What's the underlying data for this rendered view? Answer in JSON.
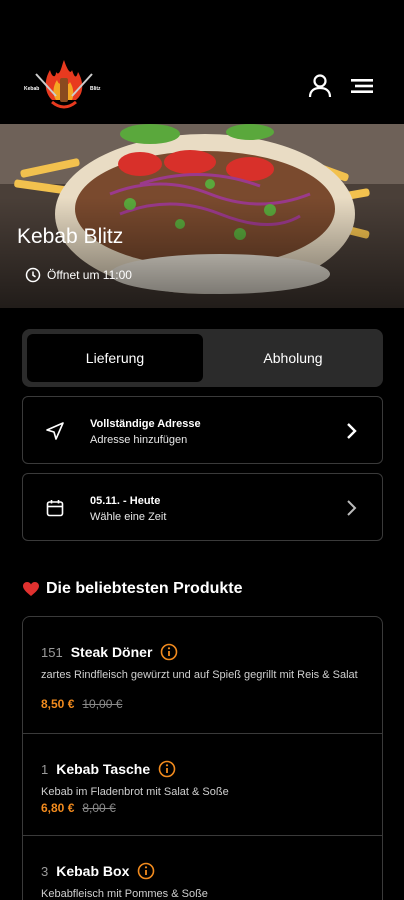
{
  "brand": {
    "name": "Kebab Blitz",
    "logo_text_left": "Kebab",
    "logo_text_right": "Blitz"
  },
  "header": {
    "account_icon": "user-icon",
    "menu_icon": "menu-icon"
  },
  "hero": {
    "title": "Kebab Blitz",
    "hours": "Öffnet um 11:00",
    "hours_icon": "clock-icon"
  },
  "order_mode": {
    "active": "Lieferung",
    "inactive": "Abholung"
  },
  "address": {
    "title": "Vollständige Adresse",
    "subtitle": "Adresse hinzufügen",
    "icon": "location-arrow-icon"
  },
  "time": {
    "title": "05.11. - Heute",
    "subtitle": "Wähle eine Zeit",
    "icon": "calendar-icon"
  },
  "popular": {
    "title": "Die beliebtesten Produkte",
    "icon": "heart-icon"
  },
  "products": [
    {
      "number": "151",
      "name": "Steak Döner",
      "description": "zartes Rindfleisch gewürzt und auf Spieß gegrillt mit Reis & Salat",
      "price": "8,50 €",
      "old_price": "10,00 €"
    },
    {
      "number": "1",
      "name": "Kebab Tasche",
      "description": "Kebab im Fladenbrot mit Salat & Soße",
      "price": "6,80 €",
      "old_price": "8,00 €"
    },
    {
      "number": "3",
      "name": "Kebab Box",
      "description": "Kebabfleisch mit Pommes & Soße",
      "price": "",
      "old_price": ""
    }
  ],
  "colors": {
    "accent": "#f28b1e",
    "background": "#000000",
    "toggle_bg": "#2b2b2b",
    "border": "#3a3a3a",
    "heart": "#e0312f"
  }
}
